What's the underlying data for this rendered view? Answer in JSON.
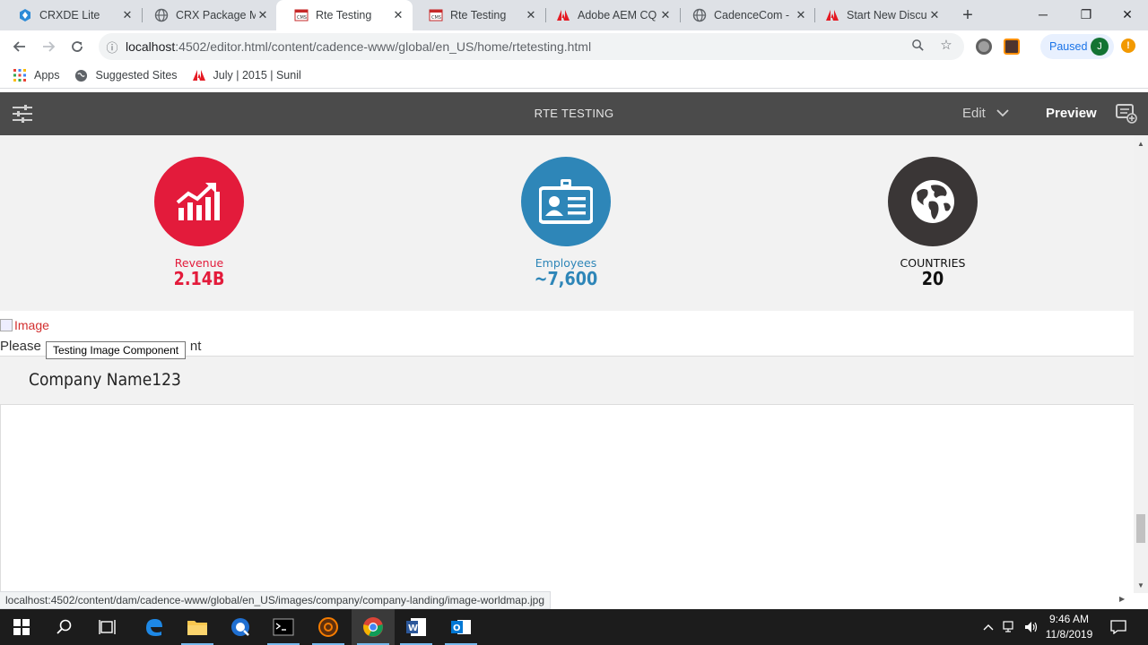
{
  "browser": {
    "tabs": [
      {
        "title": "CRXDE Lite",
        "icon": "crxde-icon"
      },
      {
        "title": "CRX Package M",
        "icon": "globe-icon"
      },
      {
        "title": "Rte Testing",
        "icon": "cms-icon"
      },
      {
        "title": "Rte Testing",
        "icon": "cms-icon"
      },
      {
        "title": "Adobe AEM CQ",
        "icon": "adobe-icon"
      },
      {
        "title": "CadenceCom -",
        "icon": "globe-icon"
      },
      {
        "title": "Start New Discu",
        "icon": "adobe-icon"
      }
    ],
    "url_host": "localhost",
    "url_rest": ":4502/editor.html/content/cadence-www/global/en_US/home/rtetesting.html",
    "profile_status": "Paused",
    "profile_initial": "J",
    "alert_symbol": "!",
    "bookmarks": [
      {
        "label": "Apps"
      },
      {
        "label": "Suggested Sites"
      },
      {
        "label": "July | 2015 | Sunil"
      }
    ],
    "status_url": "localhost:4502/content/dam/cadence-www/global/en_US/images/company/company-landing/image-worldmap.jpg"
  },
  "aem": {
    "page_title": "RTE TESTING",
    "edit_label": "Edit",
    "preview_label": "Preview"
  },
  "page": {
    "stats": [
      {
        "label": "Revenue",
        "value": "2.14B",
        "color": "#e31b3b",
        "icon": "revenue-chart-icon"
      },
      {
        "label": "Employees",
        "value": "~7,600",
        "color": "#2e86b8",
        "icon": "id-badge-icon"
      },
      {
        "label": "COUNTRIES",
        "value": "20",
        "color": "#3a3636",
        "icon": "globe-icon"
      }
    ],
    "image_alt": "Image",
    "please_text_start": "Please",
    "please_text_end": "nt",
    "tooltip": "Testing Image Component",
    "company_name": "Company Name123"
  },
  "taskbar": {
    "time": "9:46 AM",
    "date": "11/8/2019"
  }
}
